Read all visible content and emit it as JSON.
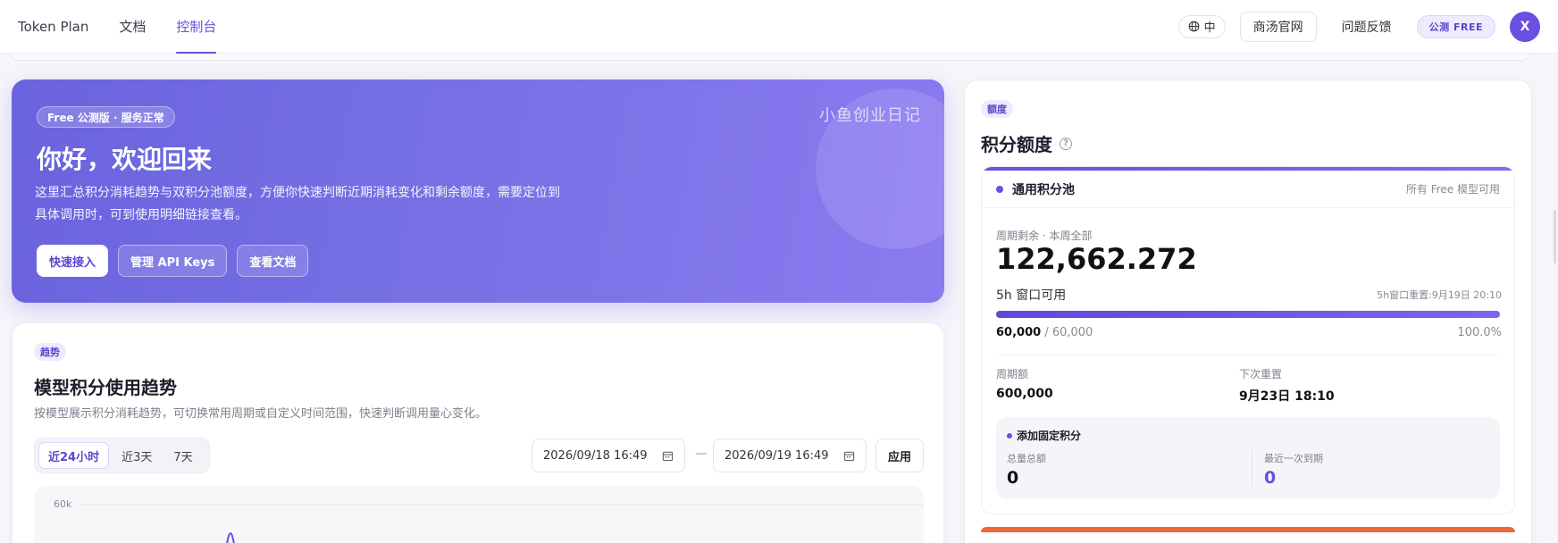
{
  "nav": {
    "brand": "Token Plan",
    "items": [
      {
        "label": "文档",
        "active": false
      },
      {
        "label": "控制台",
        "active": true
      }
    ],
    "language": "中",
    "official_site": "商汤官网",
    "feedback": "问题反馈",
    "plan_badge": "公测 FREE",
    "avatar_initial": "X"
  },
  "hero": {
    "badge": "Free 公测版 · 服务正常",
    "title": "你好，欢迎回来",
    "description": "这里汇总积分消耗趋势与双积分池额度，方便你快速判断近期消耗变化和剩余额度，需要定位到具体调用时，可到使用明细链接查看。",
    "watermark": "小鱼创业日记",
    "buttons": [
      "快速接入",
      "管理 API Keys",
      "查看文档"
    ]
  },
  "trend": {
    "tag": "趋势",
    "title": "模型积分使用趋势",
    "subtitle": "按模型展示积分消耗趋势，可切换常用周期或自定义时间范围，快速判断调用量心变化。",
    "ranges": [
      "近24小时",
      "近3天",
      "7天"
    ],
    "active_range": "近24小时",
    "date_from": "2026/09/18 16:49",
    "date_to": "2026/09/19 16:49",
    "separator": "—",
    "apply": "应用",
    "y_axis_top_label": "60k"
  },
  "credits": {
    "tag": "额度",
    "title": "积分额度",
    "pool": {
      "name": "通用积分池",
      "note": "所有 Free 模型可用",
      "remain_label": "周期剩余 · 本周全部",
      "remain_value": "122,662.272",
      "window_label": "5h 窗口可用",
      "window_reset": "5h窗口重置:9月19日 20:10",
      "window_used_display": "60,000",
      "window_total_display": "/ 60,000",
      "window_percent": "100.0%",
      "window_fraction": 1.0,
      "cycle_label": "周期额",
      "cycle_value": "600,000",
      "next_reset_label": "下次重置",
      "next_reset_value": "9月23日 18:10"
    },
    "fixed": {
      "title": "添加固定积分",
      "total_label": "总量总额",
      "total_value": "0",
      "recent_label": "最近一次到期",
      "recent_value": "0"
    }
  },
  "colors": {
    "accent": "#6a4fe0",
    "hero_start": "#6a63de",
    "hero_end": "#8b7af0",
    "next_card": "#f0683a"
  }
}
